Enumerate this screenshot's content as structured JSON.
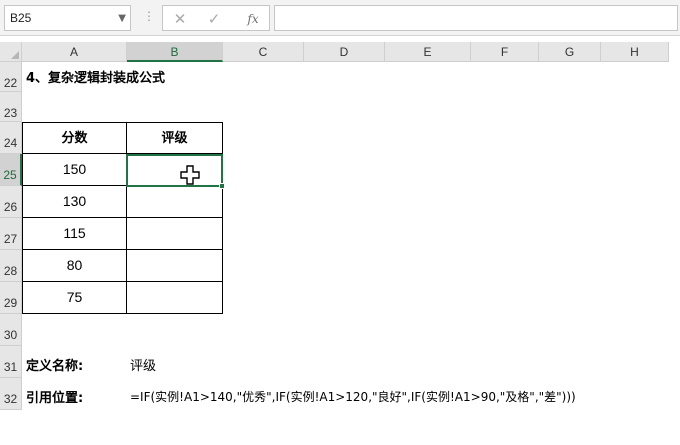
{
  "formula_bar": {
    "name_box": "B25",
    "cancel_icon": "✕",
    "enter_icon": "✓",
    "fx_label": "fx",
    "formula_value": ""
  },
  "columns": [
    "A",
    "B",
    "C",
    "D",
    "E",
    "F",
    "G",
    "H"
  ],
  "rows": [
    "22",
    "23",
    "24",
    "25",
    "26",
    "27",
    "28",
    "29",
    "30",
    "31",
    "32"
  ],
  "selected_cell": {
    "column": "B",
    "row": "25"
  },
  "sheet": {
    "title": "4、复杂逻辑封装成公式",
    "table": {
      "header_a": "分数",
      "header_b": "评级",
      "scores": [
        "150",
        "130",
        "115",
        "80",
        "75"
      ]
    },
    "define_label": "定义名称:",
    "define_value": "评级",
    "ref_label": "引用位置:",
    "ref_formula": "=IF(实例!A1>140,\"优秀\",IF(实例!A1>120,\"良好\",IF(实例!A1>90,\"及格\",\"差\")))"
  },
  "colors": {
    "accent": "#217346",
    "header_bg": "#e6e6e6",
    "selected_header_bg": "#d2d2d2"
  }
}
